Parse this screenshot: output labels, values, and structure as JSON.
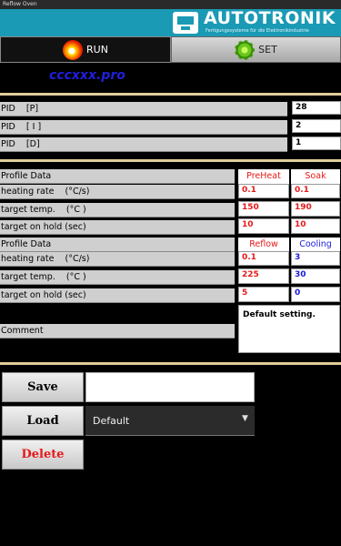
{
  "window": {
    "title": "Reflow Oven"
  },
  "brand": {
    "name": "AUTOTRONIK",
    "tagline": "Fertigungssysteme für die Elektronikindustrie"
  },
  "tabs": [
    {
      "label": "RUN",
      "icon": "flame-icon"
    },
    {
      "label": "SET",
      "icon": "gear-icon"
    }
  ],
  "profile_file": "cccxxx.pro",
  "pid": [
    {
      "label": "PID    [P]",
      "value": "28"
    },
    {
      "label": "PID    [ I ]",
      "value": "2"
    },
    {
      "label": "PID    [D]",
      "value": "1"
    }
  ],
  "profile_a": {
    "header": "Profile Data",
    "col1": "PreHeat",
    "col2": "Soak",
    "rows": [
      {
        "label": "heating rate    (°C/s)",
        "v1": "0.1",
        "v2": "0.1"
      },
      {
        "label": "target temp.    (°C )",
        "v1": "150",
        "v2": "190"
      },
      {
        "label": "target on hold (sec)",
        "v1": "10",
        "v2": "10"
      }
    ]
  },
  "profile_b": {
    "header": "Profile Data",
    "col1": "Reflow",
    "col2": "Cooling",
    "rows": [
      {
        "label": "heating rate    (°C/s)",
        "v1": "0.1",
        "v2": "3"
      },
      {
        "label": "target temp.    (°C )",
        "v1": "225",
        "v2": "30"
      },
      {
        "label": "target on hold (sec)",
        "v1": "5",
        "v2": "0"
      }
    ]
  },
  "comment": {
    "label": "Comment",
    "value": "Default setting."
  },
  "actions": {
    "save_label": "Save",
    "save_name_value": "",
    "load_label": "Load",
    "load_selected": "Default",
    "delete_label": "Delete"
  },
  "colors": {
    "header": "#1a9ab4",
    "red_text": "#e61919",
    "blue_text": "#1a1ad6",
    "separator": "#e0ce9a"
  }
}
